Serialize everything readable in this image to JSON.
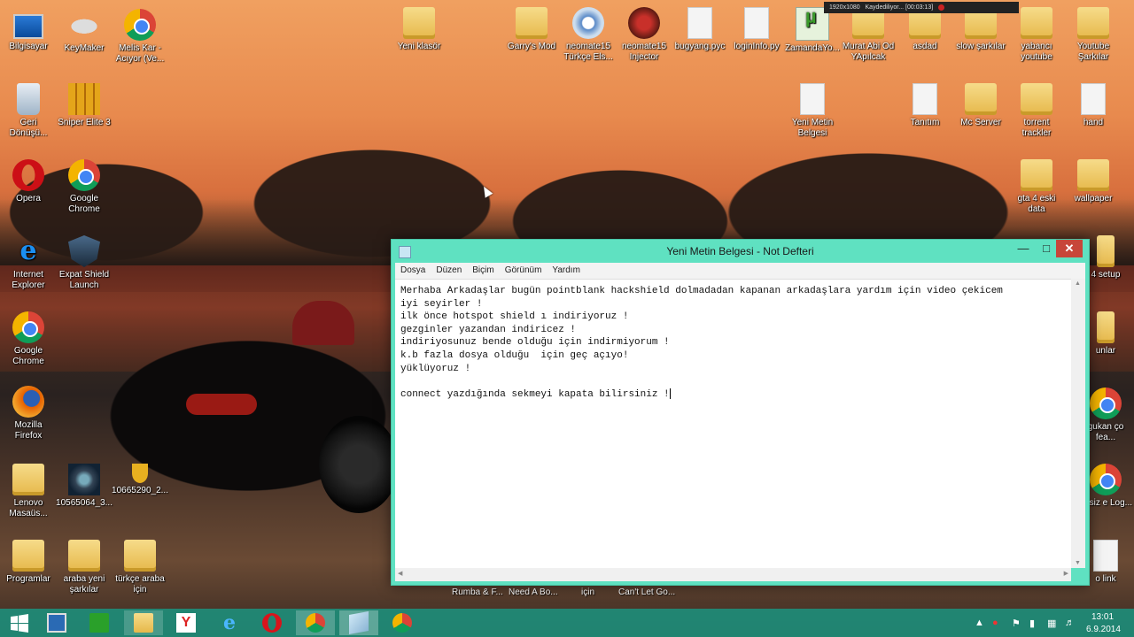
{
  "desktop": {
    "left_icons": [
      {
        "label": "Bilgisayar",
        "icon": "computer-icon"
      },
      {
        "label": "KeyMaker",
        "icon": "keymaker-icon"
      },
      {
        "label": "Melis Kar - Acıyor (Ve...",
        "icon": "chrome-shortcut-icon"
      },
      {
        "label": "Geri Dönüşü...",
        "icon": "recycle-bin-icon"
      },
      {
        "label": "Sniper Elite 3",
        "icon": "sniper-elite-icon"
      },
      {
        "label": "Opera",
        "icon": "opera-icon"
      },
      {
        "label": "Google Chrome",
        "icon": "chrome-icon"
      },
      {
        "label": "Internet Explorer",
        "icon": "ie-icon"
      },
      {
        "label": "Expat Shield Launch",
        "icon": "shield-icon"
      },
      {
        "label": "Google Chrome",
        "icon": "chrome-icon"
      },
      {
        "label": "Mozilla Firefox",
        "icon": "firefox-icon"
      },
      {
        "label": "Lenovo Masaüs...",
        "icon": "folder-icon"
      },
      {
        "label": "10565064_3...",
        "icon": "image-icon"
      },
      {
        "label": "10665290_2...",
        "icon": "image-icon"
      },
      {
        "label": "Programlar",
        "icon": "folder-icon"
      },
      {
        "label": "araba yeni şarkılar",
        "icon": "folder-icon"
      },
      {
        "label": "türkçe araba için",
        "icon": "folder-icon"
      }
    ],
    "top_icons": [
      {
        "label": "Yeni klasör",
        "icon": "folder-icon"
      },
      {
        "label": "Garry's Mod",
        "icon": "folder-icon"
      },
      {
        "label": "neomate15 Türkçe Els...",
        "icon": "gear-icon"
      },
      {
        "label": "neomate15 Injector",
        "icon": "m2-icon"
      },
      {
        "label": "bugyang.pyc",
        "icon": "file-icon"
      },
      {
        "label": "loginInfo.py",
        "icon": "file-icon"
      },
      {
        "label": "ZamandaYo...",
        "icon": "utorrent-icon"
      },
      {
        "label": "Murat Abi Od YApılcak",
        "icon": "folder-icon"
      },
      {
        "label": "asdad",
        "icon": "folder-icon"
      },
      {
        "label": "slow şarkılar",
        "icon": "folder-icon"
      },
      {
        "label": "yabancı youtube",
        "icon": "folder-icon"
      },
      {
        "label": "Youtube Şarkılar",
        "icon": "folder-icon"
      }
    ],
    "right_icons": [
      {
        "label": "Yeni Metin Belgesi",
        "icon": "file-icon"
      },
      {
        "label": "Tanıtım",
        "icon": "file-icon"
      },
      {
        "label": "Mc Server",
        "icon": "folder-icon"
      },
      {
        "label": "torrent trackler",
        "icon": "folder-icon"
      },
      {
        "label": "hand",
        "icon": "file-icon"
      },
      {
        "label": "gta 4 eski data",
        "icon": "folder-icon"
      },
      {
        "label": "wallpaper",
        "icon": "folder-icon"
      },
      {
        "label": "4 setup",
        "icon": "folder-icon"
      },
      {
        "label": "unlar",
        "icon": "folder-icon"
      },
      {
        "label": "gukan ço fea...",
        "icon": "chrome-icon"
      },
      {
        "label": "retsiz e Log...",
        "icon": "chrome-icon"
      },
      {
        "label": "o link",
        "icon": "file-icon"
      }
    ],
    "hidden_labels": [
      "Rumba & F...",
      "Need A Bo...",
      "için",
      "Can't Let Go..."
    ]
  },
  "recorder": {
    "resolution": "1920x1080",
    "status": "Kaydediliyor... [00:03:13]"
  },
  "notepad": {
    "title": "Yeni Metin Belgesi - Not Defteri",
    "menu": [
      "Dosya",
      "Düzen",
      "Biçim",
      "Görünüm",
      "Yardım"
    ],
    "lines": [
      "Merhaba Arkadaşlar bugün pointblank hackshield dolmadadan kapanan arkadaşlara yardım için video çekicem",
      "iyi seyirler !",
      "ilk önce hotspot shield ı indiriyoruz !",
      "gezginler yazandan indiricez !",
      "indiriyosunuz bende olduğu için indirmiyorum !",
      "k.b fazla dosya olduğu  için geç açıyo!",
      "yüklüyoruz !",
      "",
      "connect yazdığında sekmeyi kapata bilirsiniz !"
    ]
  },
  "taskbar": {
    "items": [
      "start-icon",
      "desktop-icon",
      "store-icon",
      "file-explorer-icon",
      "yandex-icon",
      "ie-icon",
      "opera-icon",
      "chrome-icon",
      "notepad-icon",
      "chrome-icon"
    ],
    "time": "13:01",
    "date": "6.9.2014"
  }
}
